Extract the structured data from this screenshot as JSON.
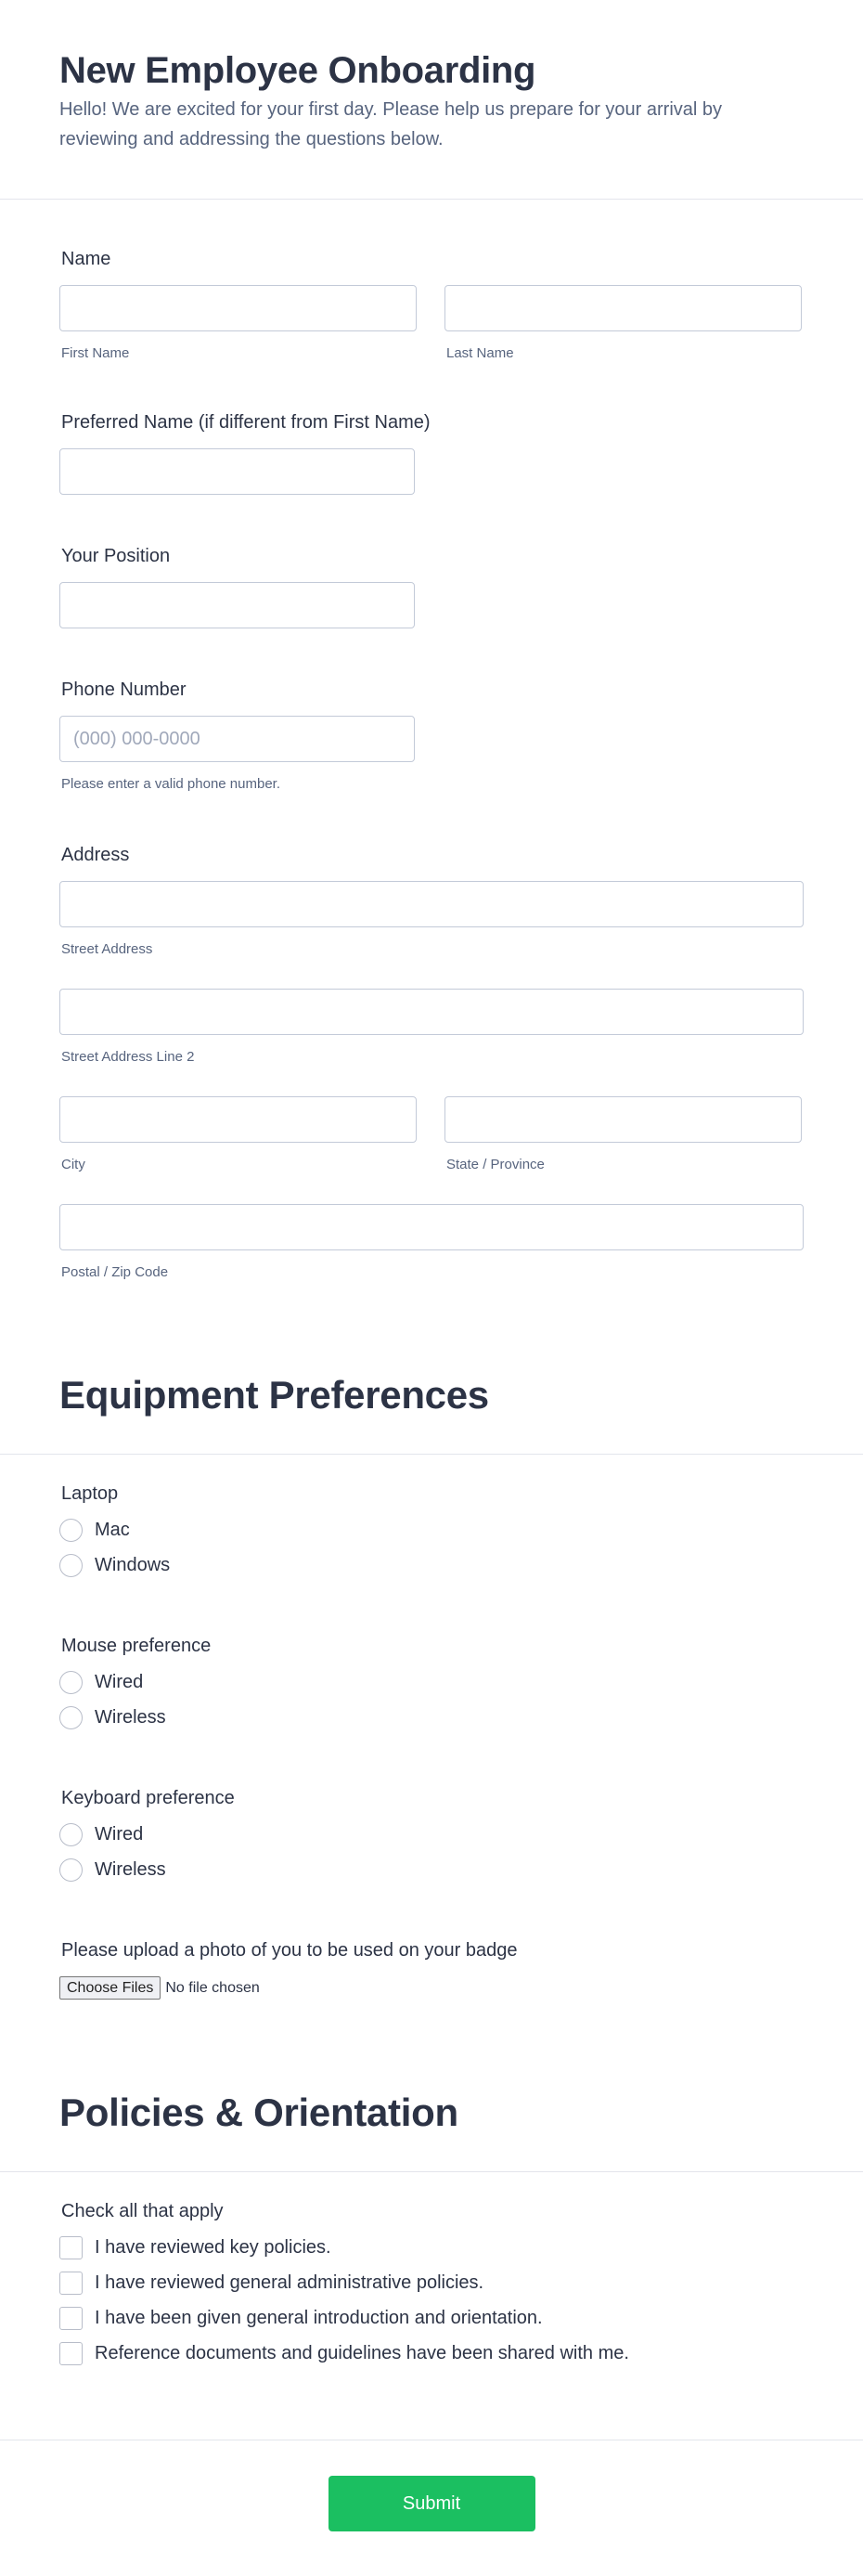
{
  "header": {
    "title": "New Employee Onboarding",
    "subtitle": "Hello! We are excited for your first day. Please help us prepare for your arrival by reviewing and addressing the questions below."
  },
  "fields": {
    "name": {
      "label": "Name",
      "first_sublabel": "First Name",
      "last_sublabel": "Last Name",
      "first_value": "",
      "last_value": ""
    },
    "preferred_name": {
      "label": "Preferred Name (if different from First Name)",
      "value": ""
    },
    "position": {
      "label": "Your Position",
      "value": ""
    },
    "phone": {
      "label": "Phone Number",
      "placeholder": "(000) 000-0000",
      "value": "",
      "hint": "Please enter a valid phone number."
    },
    "address": {
      "label": "Address",
      "street_sublabel": "Street Address",
      "street2_sublabel": "Street Address Line 2",
      "city_sublabel": "City",
      "state_sublabel": "State / Province",
      "zip_sublabel": "Postal / Zip Code"
    }
  },
  "equipment": {
    "heading": "Equipment Preferences",
    "laptop": {
      "label": "Laptop",
      "options": [
        "Mac",
        "Windows"
      ]
    },
    "mouse": {
      "label": "Mouse preference",
      "options": [
        "Wired",
        "Wireless"
      ]
    },
    "keyboard": {
      "label": "Keyboard preference",
      "options": [
        "Wired",
        "Wireless"
      ]
    },
    "photo": {
      "label": "Please upload a photo of you to be used on your badge",
      "button": "Choose Files",
      "status": "No file chosen"
    }
  },
  "policies": {
    "heading": "Policies & Orientation",
    "label": "Check all that apply",
    "options": [
      "I have reviewed key policies.",
      "I have reviewed general administrative policies.",
      "I have been given general introduction and orientation.",
      "Reference documents and guidelines have been shared with me."
    ]
  },
  "footer": {
    "submit_label": "Submit"
  },
  "colors": {
    "accent": "#1bbf61",
    "text": "#2c3345",
    "muted": "#57647e",
    "border": "#c3cad8"
  }
}
